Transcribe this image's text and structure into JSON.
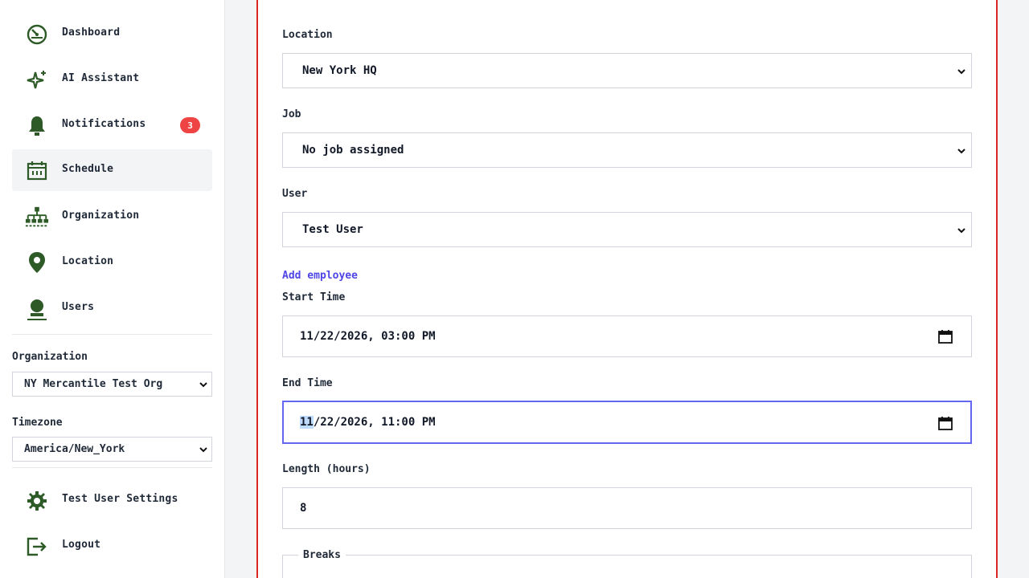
{
  "sidebar": {
    "nav": [
      {
        "label": "Dashboard",
        "icon": "dashboard-icon"
      },
      {
        "label": "AI Assistant",
        "icon": "sparkle-icon"
      },
      {
        "label": "Notifications",
        "icon": "bell-icon",
        "badge": "3"
      },
      {
        "label": "Schedule",
        "icon": "calendar-icon",
        "active": true
      },
      {
        "label": "Organization",
        "icon": "org-chart-icon"
      },
      {
        "label": "Location",
        "icon": "map-pin-icon"
      },
      {
        "label": "Users",
        "icon": "user-icon"
      }
    ],
    "organization": {
      "label": "Organization",
      "value": "NY Mercantile Test Org"
    },
    "timezone": {
      "label": "Timezone",
      "value": "America/New_York"
    },
    "settings": {
      "label": "Test User Settings",
      "icon": "gear-icon"
    },
    "logout": {
      "label": "Logout",
      "icon": "logout-icon"
    }
  },
  "form": {
    "location": {
      "label": "Location",
      "value": "New York HQ"
    },
    "job": {
      "label": "Job",
      "value": "No job assigned"
    },
    "user": {
      "label": "User",
      "value": "Test User"
    },
    "add_employee": "Add employee",
    "start_time": {
      "label": "Start Time",
      "value": "11/22/2026, 03:00 PM"
    },
    "end_time": {
      "label": "End Time",
      "month": "11",
      "rest": "/22/2026, 11:00 PM"
    },
    "length": {
      "label": "Length (hours)",
      "value": "8"
    },
    "breaks": {
      "legend": "Breaks"
    }
  },
  "colors": {
    "icon_green": "#2d5a27",
    "badge_red": "#ef4444",
    "panel_border": "#dc2626",
    "focus_border": "#6366f1",
    "link": "#4f46e5"
  }
}
